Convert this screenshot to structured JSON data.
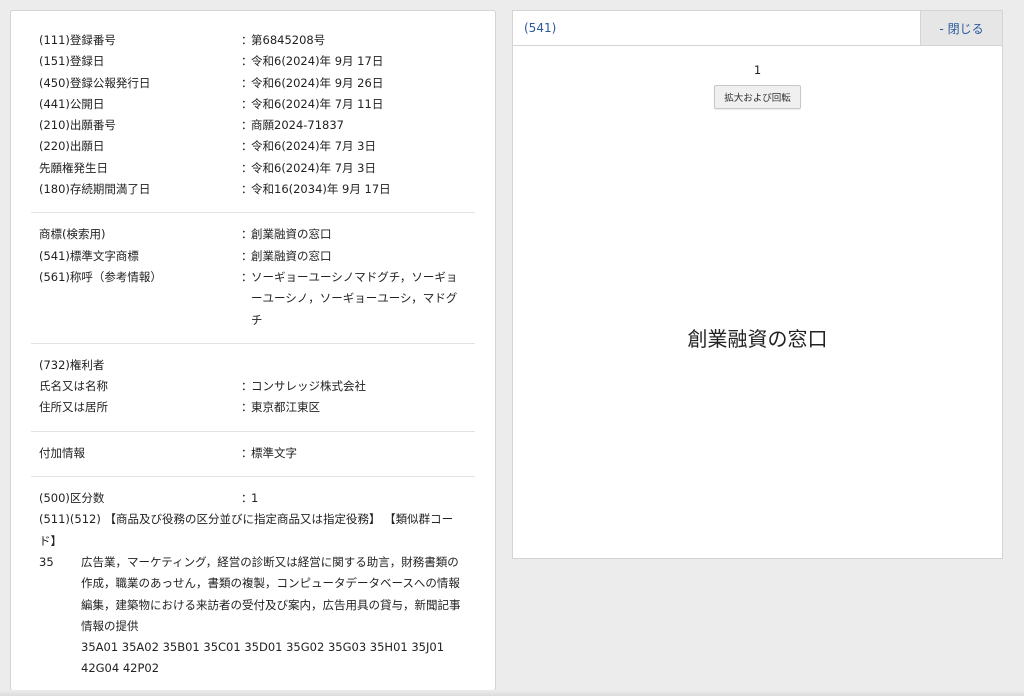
{
  "bibliographic": [
    {
      "label": "(111)登録番号",
      "value": "第6845208号"
    },
    {
      "label": "(151)登録日",
      "value": "令和6(2024)年 9月 17日"
    },
    {
      "label": "(450)登録公報発行日",
      "value": "令和6(2024)年 9月 26日"
    },
    {
      "label": "(441)公開日",
      "value": "令和6(2024)年 7月 11日"
    },
    {
      "label": "(210)出願番号",
      "value": "商願2024-71837"
    },
    {
      "label": "(220)出願日",
      "value": "令和6(2024)年 7月 3日"
    },
    {
      "label": "先願権発生日",
      "value": "令和6(2024)年 7月 3日"
    },
    {
      "label": "(180)存続期間満了日",
      "value": "令和16(2034)年 9月 17日"
    }
  ],
  "trademark": [
    {
      "label": "商標(検索用)",
      "value": "創業融資の窓口"
    },
    {
      "label": "(541)標準文字商標",
      "value": "創業融資の窓口"
    },
    {
      "label": "(561)称呼（参考情報）",
      "value": "ソーギョーユーシノマドグチ，ソーギョーユーシノ，ソーギョーユーシ，マドグチ"
    }
  ],
  "owner": {
    "heading": "(732)権利者",
    "rows": [
      {
        "label": "氏名又は名称",
        "value": "コンサレッジ株式会社"
      },
      {
        "label": "住所又は居所",
        "value": "東京都江東区"
      }
    ]
  },
  "additional": {
    "label": "付加情報",
    "value": "標準文字"
  },
  "classification": {
    "count_label": "(500)区分数",
    "count_value": "1",
    "goods_heading": "(511)(512) 【商品及び役務の区分並びに指定商品又は指定役務】 【類似群コード】",
    "class_number": "35",
    "class_description": "広告業，マーケティング，経営の診断又は経営に関する助言，財務書類の作成，職業のあっせん，書類の複製，コンピュータデータベースへの情報編集，建築物における来訪者の受付及び案内，広告用具の貸与，新聞記事情報の提供",
    "similar_codes": "35A01 35A02 35B01 35C01 35D01 35G02 35G03 35H01 35J01 42G04 42P02"
  },
  "colon": "：",
  "viewer": {
    "title": "(541)",
    "close_label": "- 閉じる",
    "page_number": "1",
    "zoom_label": "拡大および回転",
    "mark_text": "創業融資の窓口"
  }
}
